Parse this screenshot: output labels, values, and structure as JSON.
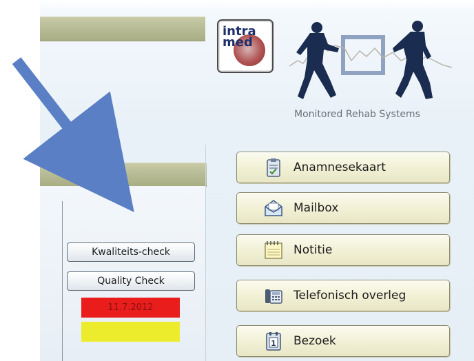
{
  "logo": {
    "line1": "intra",
    "line2": "med"
  },
  "header": {
    "tagline": "Monitored Rehab Systems"
  },
  "menu": {
    "items": [
      {
        "label": "Anamnesekaart",
        "icon": "clipboard-icon"
      },
      {
        "label": "Mailbox",
        "icon": "envelope-icon"
      },
      {
        "label": "Notitie",
        "icon": "notepad-icon"
      },
      {
        "label": "Telefonisch overleg",
        "icon": "telephone-icon"
      },
      {
        "label": "Bezoek",
        "icon": "calendar-icon"
      }
    ]
  },
  "quality": {
    "kwaliteits_label": "Kwaliteits-check",
    "quality_label": "Quality Check",
    "date": "11.7.2012"
  },
  "colors": {
    "olive": "#b6ba93",
    "button_bg": "#f1f0d4",
    "status_red": "#ea1d1d",
    "status_yellow": "#ecec2c",
    "arrow": "#5b7fc4"
  }
}
